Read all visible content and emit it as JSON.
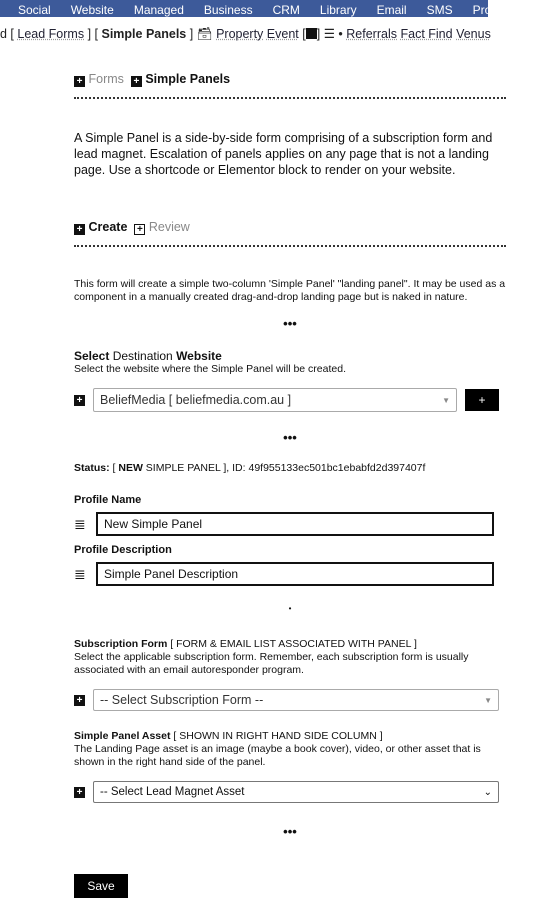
{
  "nav": {
    "items": [
      "Social",
      "Website",
      "Managed",
      "Business",
      "CRM",
      "Library",
      "Email",
      "SMS",
      "Property"
    ]
  },
  "subnav": {
    "d": "d [",
    "lead_forms": "Lead Forms",
    "b1": "] [",
    "simple_panels": "Simple Panels",
    "b2": "]",
    "property": "Property",
    "event": "Event",
    "b3": "[",
    "b4": "]",
    "dot": "•",
    "referrals": "Referrals",
    "fact_find": "Fact Find",
    "venus": "Venus"
  },
  "tabs1": {
    "forms": "Forms",
    "simple_panels": "Simple Panels"
  },
  "intro": {
    "t1": "A Simple Panel is a side-by-side form comprising of a ",
    "link1": "subscription form",
    "t2": " and ",
    "link2": "lead magnet",
    "t3": ". ",
    "link3": "Escalation",
    "t4": " of panels applies on any page that is not a landing page. Use a shortcode or Elementor block to render on your website."
  },
  "tabs2": {
    "create": "Create",
    "review": "Review"
  },
  "desc": "This form will create a simple two-column 'Simple Panel' \"landing panel\". It may be used as a component in a manually created drag-and-drop landing page but is naked in nature.",
  "ellipsis": "•••",
  "dest": {
    "b1": "Select",
    "m": " Destination ",
    "b2": "Website",
    "help": "Select the website where the Simple Panel will be created.",
    "value": "BeliefMedia [ beliefmedia.com.au ]",
    "add": "+"
  },
  "status": {
    "label": "Status:",
    "open": " [ ",
    "state_b": "NEW",
    "state": " SIMPLE PANEL ], ID: 49f955133ec501bc1ebabfd2d397407f"
  },
  "profile_name": {
    "label": "Profile Name",
    "value": "New Simple Panel"
  },
  "profile_desc": {
    "label": "Profile Description",
    "value": "Simple Panel Description"
  },
  "small_dot": "•",
  "subform": {
    "label": "Subscription Form",
    "tag": " [ FORM & EMAIL LIST ASSOCIATED WITH PANEL ]",
    "help": "Select the applicable subscription form. Remember, each subscription form is usually associated with an email autoresponder program.",
    "value": "-- Select Subscription Form --"
  },
  "asset": {
    "label": "Simple Panel Asset",
    "tag": " [ SHOWN IN RIGHT HAND SIDE COLUMN ]",
    "help": "The Landing Page asset is an image (maybe a book cover), video, or other asset that is shown in the right hand side of the panel.",
    "value": "-- Select Lead Magnet Asset"
  },
  "save": "Save"
}
